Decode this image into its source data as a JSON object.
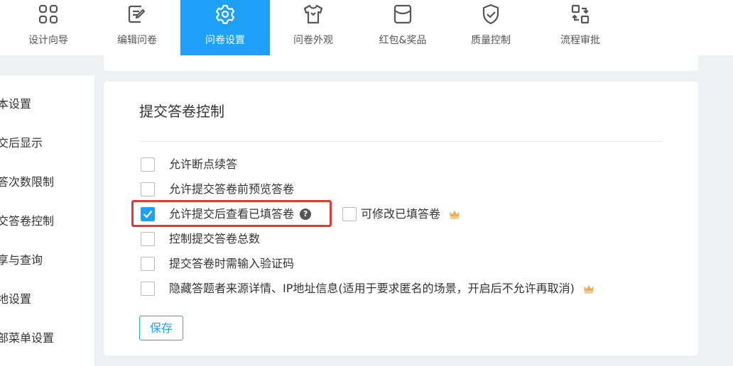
{
  "toolbar": {
    "tabs": [
      {
        "label": "设计向导",
        "icon": "grid-icon"
      },
      {
        "label": "编辑问卷",
        "icon": "edit-icon"
      },
      {
        "label": "问卷设置",
        "icon": "gear-icon",
        "active": true
      },
      {
        "label": "问卷外观",
        "icon": "shirt-icon"
      },
      {
        "label": "红包&奖品",
        "icon": "envelope-icon"
      },
      {
        "label": "质量控制",
        "icon": "shield-check-icon"
      },
      {
        "label": "流程审批",
        "icon": "flow-icon"
      }
    ]
  },
  "sidebar": {
    "items": [
      {
        "label": "本设置"
      },
      {
        "label": "交后显示"
      },
      {
        "label": "答次数限制"
      },
      {
        "label": "交答卷控制"
      },
      {
        "label": "享与查询"
      },
      {
        "label": "地设置"
      },
      {
        "label": "部菜单设置"
      }
    ]
  },
  "section": {
    "title": "提交答卷控制",
    "options": [
      {
        "label": "允许断点续答",
        "checked": false
      },
      {
        "label": "允许提交答卷前预览答卷",
        "checked": false
      },
      {
        "label": "允许提交后查看已填答卷",
        "checked": true,
        "help": "?",
        "sub_option": {
          "label": "可修改已填答卷",
          "checked": false,
          "premium_icon": "crown-icon"
        }
      },
      {
        "label": "控制提交答卷总数",
        "checked": false
      },
      {
        "label": "提交答卷时需输入验证码",
        "checked": false
      },
      {
        "label": "隐藏答题者来源详情、IP地址信息(适用于要求匿名的场景，开启后不允许再取消)",
        "checked": false,
        "premium_icon": "crown-icon"
      }
    ],
    "save_label": "保存"
  },
  "colors": {
    "accent": "#1ea0fa",
    "highlight_border": "#e03a32",
    "crown": "#e8b05a"
  }
}
